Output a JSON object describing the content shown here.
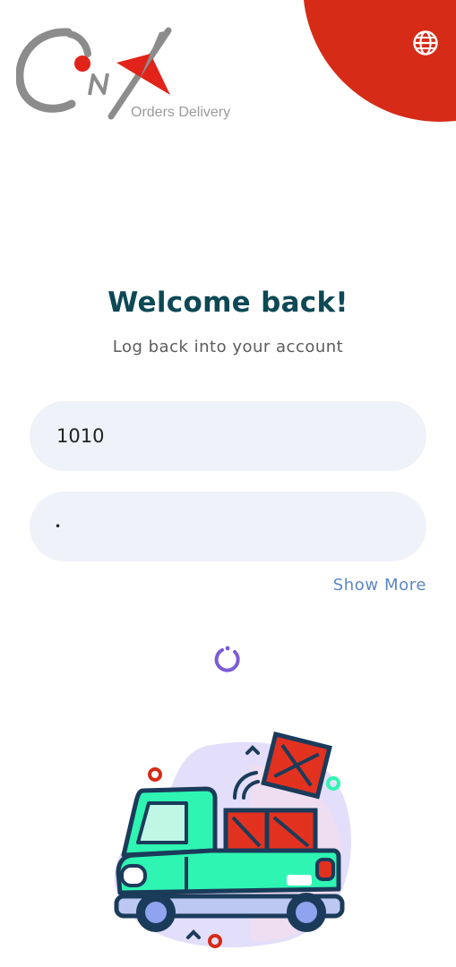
{
  "header": {
    "logo_text": "ONX",
    "logo_tagline": "Orders Delivery",
    "language_icon": "globe-icon"
  },
  "login": {
    "title": "Welcome back!",
    "subtitle": "Log back into your account",
    "username_value": "1010",
    "password_value": "•",
    "show_more_label": "Show More"
  },
  "status": {
    "loading_icon": "spinner-icon"
  },
  "illustration": {
    "subject": "delivery-truck-illustration"
  },
  "colors": {
    "brand_red": "#d62b16",
    "title": "#0d4855",
    "link": "#5e86c4",
    "field_bg": "#eff2f8",
    "spinner": "#7b5bd6",
    "truck_green": "#2ef5b2"
  }
}
